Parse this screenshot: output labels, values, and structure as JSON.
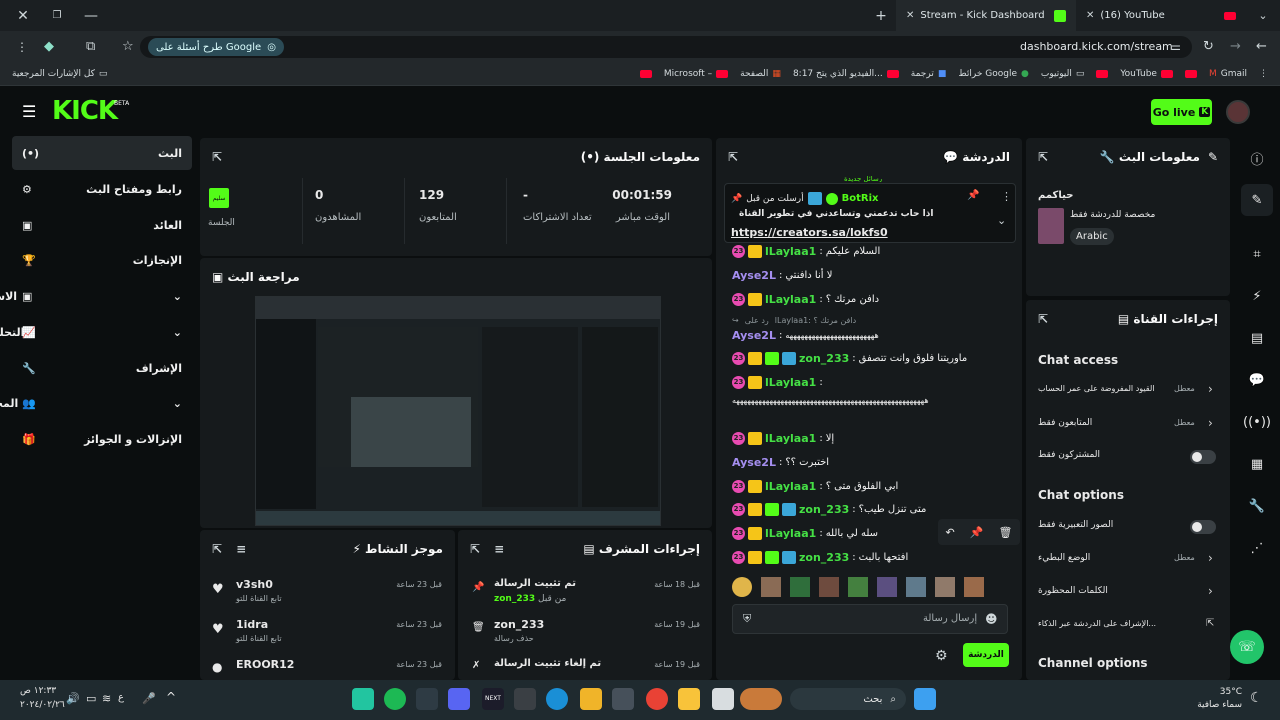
{
  "browser": {
    "tabs": [
      {
        "title": "(16) YouTube",
        "active": false
      },
      {
        "title": "Stream - Kick Dashboard",
        "active": true
      }
    ],
    "address": "dashboard.kick.com/stream",
    "search_chip": "طرح أسئلة على Google",
    "bookmarks": [
      "Gmail",
      "YouTube",
      "اليوتيوب",
      "خرائط Google",
      "ترجمة",
      "8:17 الفيديو الذي يتح...",
      "الصفحة",
      "Microsoft –",
      "كل الإشارات المرجعية"
    ]
  },
  "header": {
    "logo": "KICK",
    "beta": "BETA",
    "go_live": "Go live"
  },
  "sidebar": {
    "items": [
      {
        "label": "البث",
        "icon": "(•)"
      },
      {
        "label": "رابط ومفتاح البث",
        "icon": "⚙"
      },
      {
        "label": "العائد",
        "icon": "▣"
      },
      {
        "label": "الإنجازات",
        "icon": "🏆"
      },
      {
        "label": "الاستديو",
        "icon": "▣"
      },
      {
        "label": "التحليلات",
        "icon": "📈"
      },
      {
        "label": "الإشراف",
        "icon": "🔧"
      },
      {
        "label": "المجتمع",
        "icon": "👥"
      },
      {
        "label": "الإنزالات و الجوائز",
        "icon": "🎁"
      }
    ]
  },
  "session": {
    "title": "معلومات الجلسة",
    "stats": [
      {
        "value": "00:01:59",
        "label": "الوقت مباشر"
      },
      {
        "value": "-",
        "label": "تعداد الاشتراكات"
      },
      {
        "value": "129",
        "label": "المتابعون"
      },
      {
        "value": "0",
        "label": "المشاهدون"
      }
    ],
    "session_badge": "سليم",
    "session_label": "الجلسة"
  },
  "review": {
    "title": "مراجعة البث"
  },
  "activity": {
    "title": "موجز النشاط",
    "items": [
      {
        "name": "v3sh0",
        "sub": "تابع القناة للتو",
        "time": "قبل 23 ساعة"
      },
      {
        "name": "1idra",
        "sub": "تابع القناة للتو",
        "time": "قبل 23 ساعة"
      },
      {
        "name": "EROOR12",
        "sub": "",
        "time": "قبل 23 ساعة"
      }
    ]
  },
  "mod_actions": {
    "title": "إجراءات المشرف",
    "items": [
      {
        "title": "تم تثبيت الرسالة",
        "sub": "zon_233",
        "sub_prefix": "من قبل",
        "time": "قبل 18 ساعة"
      },
      {
        "title": "zon_233",
        "sub": "حذف رسالة",
        "sub_prefix": "",
        "time": "قبل 19 ساعة"
      },
      {
        "title": "تم إلغاء تثبيت الرسالة",
        "sub": "",
        "sub_prefix": "",
        "time": "قبل 19 ساعة"
      }
    ]
  },
  "chat": {
    "title": "الدردشة",
    "pinned": {
      "by": "أرسلت من قبل",
      "bot": "BotRix",
      "text": "اذا حاب تدعمني وتساعدني في تطوير القناة",
      "link": "https://creators.sa/lokfs0"
    },
    "messages": [
      {
        "user": "lLaylaa1",
        "color": "#45e045",
        "text": "السلام عليكم"
      },
      {
        "user": "Ayse2L",
        "color": "#a58ff0",
        "text": "لا أنا دافنتي"
      },
      {
        "user": "lLaylaa1",
        "color": "#45e045",
        "text": "دافن مرتك ؟"
      },
      {
        "user": "Ayse2L",
        "color": "#a58ff0",
        "text": "ههههههههههههههههههههههههه",
        "reply": "lLaylaa1: دافن مرتك ؟",
        "reply_to": "رد على"
      },
      {
        "user": "zon_233",
        "color": "#45e045",
        "text": "ماوريتنا فلوق وانت تتصفق"
      },
      {
        "user": "lLaylaa1",
        "color": "#45e045",
        "text": "ههههههههههههههههههههههههههههههههههههههههههههههههههههه"
      },
      {
        "user": "lLaylaa1",
        "color": "#45e045",
        "text": "إلا"
      },
      {
        "user": "Ayse2L",
        "color": "#a58ff0",
        "text": "اختبرت ؟؟"
      },
      {
        "user": "lLaylaa1",
        "color": "#45e045",
        "text": "ابي الفلوق متى ؟"
      },
      {
        "user": "zon_233",
        "color": "#45e045",
        "text": "متى تنزل طيب؟"
      },
      {
        "user": "lLaylaa1",
        "color": "#45e045",
        "text": "سله لي بالله"
      },
      {
        "user": "zon_233",
        "color": "#45e045",
        "text": "افتحها بالبث"
      }
    ],
    "placeholder": "إرسال رسالة",
    "send_label": "الدردشة",
    "new_label": "رسائل جديدة"
  },
  "stream_info": {
    "title": "معلومات البث",
    "stream_title": "حياكمم",
    "subtitle": "مخصصة للدردشة فقط",
    "tag": "Arabic"
  },
  "channel_actions": {
    "title": "إجراءات القناة",
    "chat_access": "Chat access",
    "chat_options": "Chat options",
    "channel_options": "Channel options",
    "rows": [
      {
        "label": "القيود المفروضة على عمر الحساب",
        "status": "معطل"
      },
      {
        "label": "المتابعون فقط",
        "status": "معطل"
      },
      {
        "label": "المشتركون فقط",
        "status": ""
      },
      {
        "label": "الصور التعبيرية فقط",
        "status": ""
      },
      {
        "label": "الوضع البطيء",
        "status": "معطل"
      },
      {
        "label": "الكلمات المحظورة",
        "status": ""
      },
      {
        "label": "...الإشراف على الدردشة عبر الذكاء",
        "status": ""
      }
    ]
  },
  "taskbar": {
    "search": "بحث",
    "temp": "35°C",
    "weather": "سماء صافية",
    "time": "١٢:٣٣ ص",
    "date": "٢٠٢٤/٠٢/٢٦",
    "lang": "ع"
  },
  "colors": {
    "accent": "#53fc18",
    "panel": "#161a1c",
    "bg": "#0b0e0f"
  }
}
